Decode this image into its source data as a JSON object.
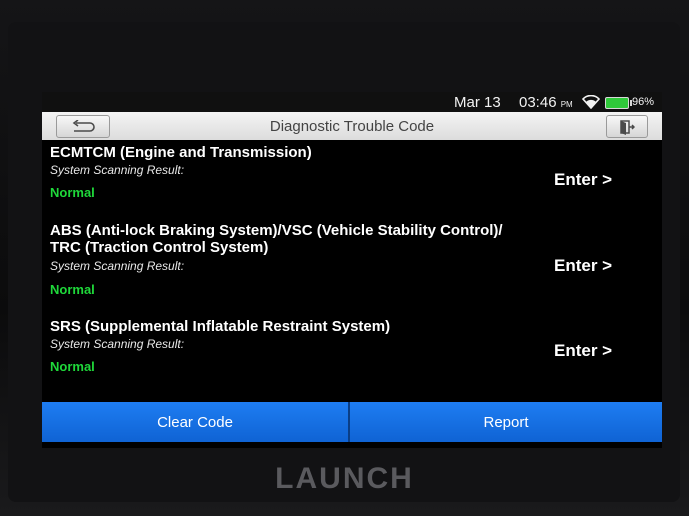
{
  "status_bar": {
    "date": "Mar 13",
    "time": "03:46",
    "am_pm": "PM",
    "battery_percent": "96%",
    "wifi_icon": "wifi-icon",
    "battery_icon": "battery-icon"
  },
  "title_bar": {
    "title": "Diagnostic Trouble Code",
    "back_icon": "back-arrow-icon",
    "exit_icon": "exit-icon"
  },
  "systems": [
    {
      "name": "ECMTCM (Engine and Transmission)",
      "scan_label": "System Scanning Result:",
      "result": "Normal",
      "enter_label": "Enter >"
    },
    {
      "name": "ABS (Anti-lock Braking System)/VSC (Vehicle Stability Control)/ TRC (Traction Control System)",
      "scan_label": "System Scanning Result:",
      "result": "Normal",
      "enter_label": "Enter >"
    },
    {
      "name": "SRS (Supplemental Inflatable Restraint System)",
      "scan_label": "System Scanning Result:",
      "result": "Normal",
      "enter_label": "Enter >"
    }
  ],
  "bottom_bar": {
    "clear_code_label": "Clear Code",
    "report_label": "Report"
  },
  "device": {
    "brand": "LAUNCH"
  },
  "colors": {
    "accent_blue": "#1670e6",
    "normal_green": "#1fd83a",
    "screen_bg": "#000000"
  }
}
